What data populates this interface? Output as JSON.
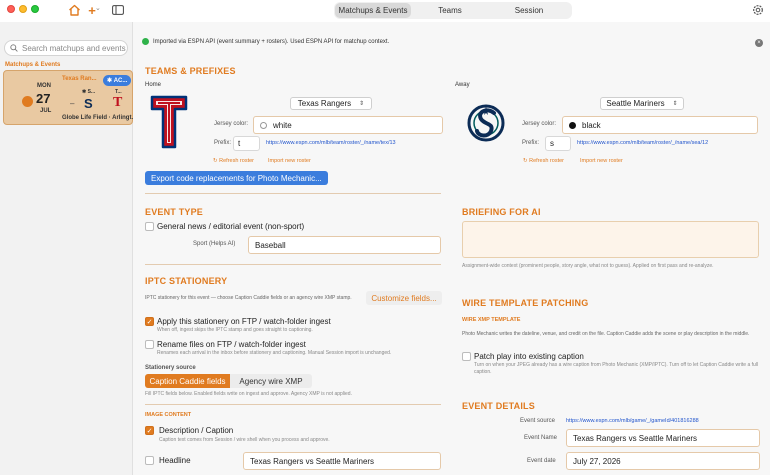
{
  "toolbar": {
    "tabs": [
      "Matchups & Events",
      "Teams",
      "Session"
    ],
    "active_tab": "Matchups & Events"
  },
  "sidebar": {
    "search_placeholder": "Search matchups and events",
    "section_label": "Matchups & Events",
    "event": {
      "dow": "MON",
      "day": "27",
      "month": "JUL",
      "title": "Texas Ran...",
      "badge": "AC...",
      "away_short": "S...",
      "home_short": "T...",
      "venue": "Globe Life Field · Arlingt..."
    }
  },
  "notice": {
    "text": "Imported via ESPN API (event summary + rosters). Used ESPN API for matchup context."
  },
  "teams": {
    "title": "TEAMS & PREFIXES",
    "home": {
      "label": "Home",
      "team": "Texas Rangers",
      "jersey_label": "Jersey color:",
      "jersey_value": "white",
      "jersey_swatch": "#ffffff",
      "prefix_label": "Prefix:",
      "prefix_value": "t",
      "roster_url": "https://www.espn.com/mlb/team/roster/_/name/tex/13",
      "refresh_label": "Refresh roster",
      "import_label": "Import new roster"
    },
    "away": {
      "label": "Away",
      "team": "Seattle Mariners",
      "jersey_label": "Jersey color:",
      "jersey_value": "black",
      "jersey_swatch": "#111111",
      "prefix_label": "Prefix:",
      "prefix_value": "s",
      "roster_url": "https://www.espn.com/mlb/team/roster/_/name/sea/12",
      "refresh_label": "Refresh roster",
      "import_label": "Import new roster"
    },
    "export_button": "Export code replacements for Photo Mechanic..."
  },
  "event_type": {
    "title": "EVENT TYPE",
    "general_news_label": "General news / editorial event (non-sport)",
    "sport_label": "Sport (Helps AI)",
    "sport_value": "Baseball"
  },
  "briefing": {
    "title": "BRIEFING FOR AI",
    "hint": "Assignment-wide context (prominent people, story angle, what not to guess). Applied on first pass and re-analyze."
  },
  "iptc": {
    "title": "IPTC STATIONERY",
    "desc": "IPTC stationery for this event — choose Caption Caddie fields or an agency wire XMP stamp.",
    "customize_button": "Customize fields...",
    "apply_label": "Apply this stationery on FTP / watch-folder ingest",
    "apply_hint": "When off, ingest skips the IPTC stamp and goes straight to captioning.",
    "rename_label": "Rename files on FTP / watch-folder ingest",
    "rename_hint": "Renames each arrival in the inbox before stationery and captioning. Manual Session import is unchanged.",
    "source_label": "Stationery source",
    "source_options": [
      "Caption Caddie fields",
      "Agency wire XMP"
    ],
    "source_hint": "Fill IPTC fields below. Enabled fields write on ingest and approve. Agency XMP is not applied.",
    "image_content_label": "IMAGE CONTENT",
    "description_label": "Description / Caption",
    "description_hint": "Caption text comes from Session / wire shell when you process and approve.",
    "headline_label": "Headline",
    "headline_value": "Texas Rangers vs Seattle Mariners"
  },
  "wire": {
    "title": "WIRE TEMPLATE PATCHING",
    "sub": "WIRE XMP TEMPLATE",
    "desc": "Photo Mechanic writes the dateline, venue, and credit on the file. Caption Caddie adds the scene or play description in the middle.",
    "patch_label": "Patch play into existing caption",
    "patch_hint": "Turn on when your JPEG already has a wire caption from Photo Mechanic (XMP/IPTC). Turn off to let Caption Caddie write a full caption."
  },
  "details": {
    "title": "EVENT DETAILS",
    "source_label": "Event source",
    "source_url": "https://www.espn.com/mlb/game/_/gameId/401816288",
    "name_label": "Event Name",
    "name_value": "Texas Rangers vs Seattle Mariners",
    "date_label": "Event date",
    "date_value": "July 27, 2026"
  },
  "colors": {
    "accent": "#e07b20",
    "link": "#2255cc",
    "primary_button": "#3b7ddd",
    "rangers_red": "#c0111f",
    "rangers_blue": "#003278",
    "mariners_navy": "#0c2c56",
    "mariners_teal": "#005c5c"
  }
}
